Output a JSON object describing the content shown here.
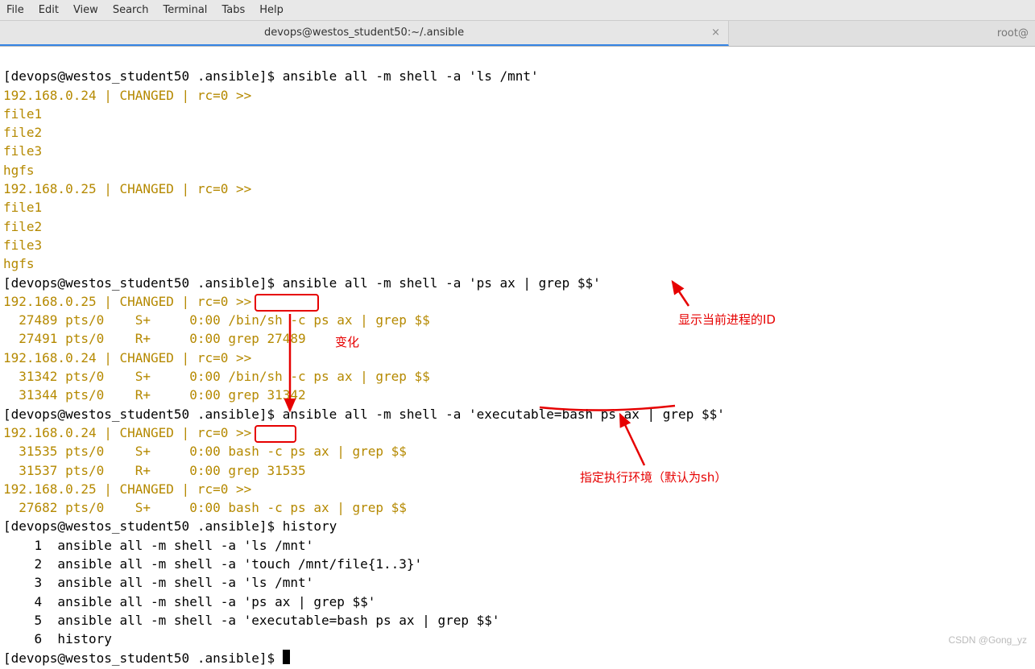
{
  "menu": {
    "file": "File",
    "edit": "Edit",
    "view": "View",
    "search": "Search",
    "terminal": "Terminal",
    "tabs": "Tabs",
    "help": "Help"
  },
  "tabs": {
    "active": "devops@westos_student50:~/.ansible",
    "inactive": "root@"
  },
  "term": {
    "l1_prompt": "[devops@westos_student50 .ansible]$ ",
    "l1_cmd": "ansible all -m shell -a 'ls /mnt'",
    "l2": "192.168.0.24 | CHANGED | rc=0 >>",
    "l3": "file1",
    "l4": "file2",
    "l5": "file3",
    "l6": "hgfs",
    "l7": "192.168.0.25 | CHANGED | rc=0 >>",
    "l8": "file1",
    "l9": "file2",
    "l10": "file3",
    "l11": "hgfs",
    "l12_prompt": "[devops@westos_student50 .ansible]$ ",
    "l12_cmd": "ansible all -m shell -a 'ps ax | grep $$'",
    "l13": "192.168.0.25 | CHANGED | rc=0 >>",
    "l14": "  27489 pts/0    S+     0:00 /bin/sh -c ps ax | grep $$",
    "l15": "  27491 pts/0    R+     0:00 grep 27489",
    "l16": "192.168.0.24 | CHANGED | rc=0 >>",
    "l17": "  31342 pts/0    S+     0:00 /bin/sh -c ps ax | grep $$",
    "l18": "  31344 pts/0    R+     0:00 grep 31342",
    "l19_prompt": "[devops@westos_student50 .ansible]$ ",
    "l19_cmd": "ansible all -m shell -a 'executable=bash ps ax | grep $$'",
    "l20": "192.168.0.24 | CHANGED | rc=0 >>",
    "l21": "  31535 pts/0    S+     0:00 bash -c ps ax | grep $$",
    "l22": "  31537 pts/0    R+     0:00 grep 31535",
    "l23": "192.168.0.25 | CHANGED | rc=0 >>",
    "l24": "  27682 pts/0    S+     0:00 bash -c ps ax | grep $$",
    "l25_prompt": "[devops@westos_student50 .ansible]$ ",
    "l25_cmd": "history",
    "l26": "    1  ansible all -m shell -a 'ls /mnt'",
    "l27": "    2  ansible all -m shell -a 'touch /mnt/file{1..3}'",
    "l28": "    3  ansible all -m shell -a 'ls /mnt'",
    "l29": "    4  ansible all -m shell -a 'ps ax | grep $$'",
    "l30": "    5  ansible all -m shell -a 'executable=bash ps ax | grep $$'",
    "l31": "    6  history",
    "l32_prompt": "[devops@westos_student50 .ansible]$ "
  },
  "annotations": {
    "change": "变化",
    "show_pid": "显示当前进程的ID",
    "exec_env": "指定执行环境（默认为sh）"
  },
  "watermark": "CSDN @Gong_yz"
}
